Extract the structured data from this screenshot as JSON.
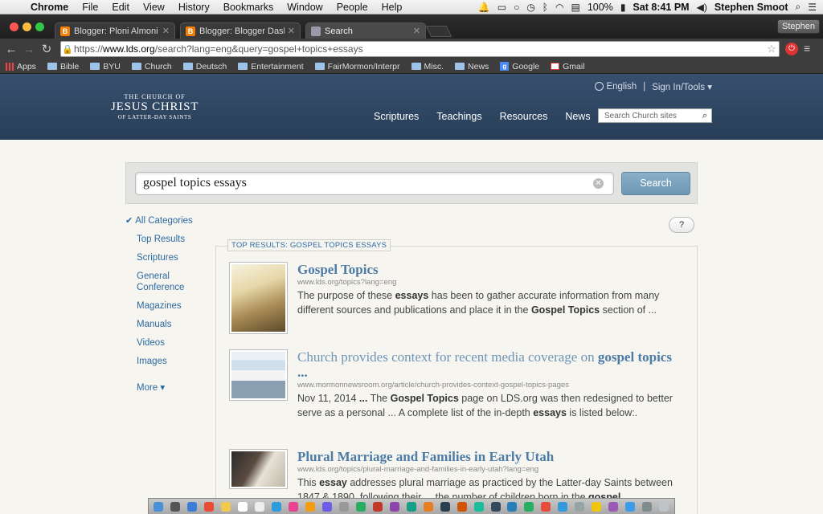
{
  "menubar": {
    "app": "Chrome",
    "items": [
      "File",
      "Edit",
      "View",
      "History",
      "Bookmarks",
      "Window",
      "People",
      "Help"
    ],
    "battery": "100%",
    "datetime": "Sat 8:41 PM",
    "user": "Stephen Smoot"
  },
  "tabs": [
    {
      "title": "Blogger: Ploni Almoni - Cre",
      "icon": "blogger-icon",
      "fav": "B"
    },
    {
      "title": "Blogger: Blogger Dashboa",
      "icon": "blogger-icon",
      "fav": "B"
    },
    {
      "title": "Search",
      "icon": "lds-icon",
      "fav": ""
    }
  ],
  "profile": "Stephen",
  "url": {
    "prefix": "https://",
    "domain": "www.lds.org",
    "path": "/search?lang=eng&query=gospel+topics+essays"
  },
  "bookmarks": [
    "Apps",
    "Bible",
    "BYU",
    "Church",
    "Deutsch",
    "Entertainment",
    "FairMormon/Interpr",
    "Misc.",
    "News",
    "Google",
    "Gmail"
  ],
  "site": {
    "logo": {
      "line1": "THE CHURCH OF",
      "line2": "JESUS CHRIST",
      "line3": "OF LATTER-DAY SAINTS"
    },
    "language": "English",
    "signin": "Sign In/Tools ▾",
    "nav": [
      "Scriptures",
      "Teachings",
      "Resources",
      "News"
    ],
    "search_placeholder": "Search Church sites"
  },
  "search": {
    "query": "gospel topics essays",
    "button": "Search"
  },
  "categories": {
    "selected": "All Categories",
    "items": [
      "Top Results",
      "Scriptures",
      "General Conference",
      "Magazines",
      "Manuals",
      "Videos",
      "Images"
    ],
    "more": "More ▾"
  },
  "help": "?",
  "results_label": "TOP RESULTS: GOSPEL TOPICS ESSAYS",
  "results": [
    {
      "title_plain": "",
      "title_bold": "Gospel Topics",
      "url": "www.lds.org/topics?lang=eng",
      "snippet": [
        "The purpose of these ",
        "essays",
        " has been to gather accurate information from many different sources and publications and place it in the ",
        "Gospel Topics",
        " section of ..."
      ]
    },
    {
      "title_plain": "Church provides context for recent media coverage on ",
      "title_bold": "gospel topics ...",
      "url": "www.mormonnewsroom.org/article/church-provides-context-gospel-topics-pages",
      "snippet": [
        "Nov 11, 2014 ",
        "...",
        " The ",
        "Gospel Topics",
        " page on LDS.org was then redesigned to better serve as a personal ... A complete list of the in-depth ",
        "essays",
        " is listed below:."
      ]
    },
    {
      "title_plain": "",
      "title_bold": "Plural Marriage and Families in Early Utah",
      "url": "www.lds.org/topics/plural-marriage-and-families-in-early-utah?lang=eng",
      "snippet": [
        "This ",
        "essay",
        " addresses plural marriage as practiced by the Latter-day Saints between 1847 & 1890, following their ... the number of children born in the ",
        "gospel",
        ""
      ]
    }
  ]
}
